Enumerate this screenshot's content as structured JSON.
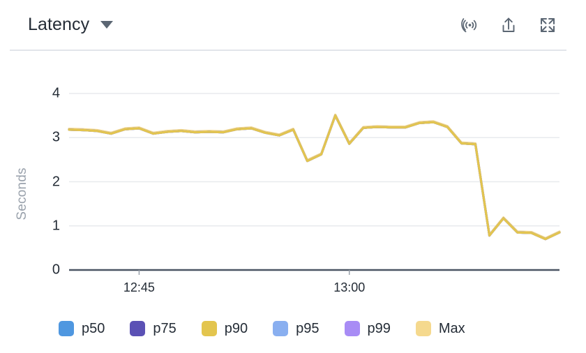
{
  "header": {
    "title": "Latency",
    "caret_icon": "chevron-down-icon",
    "actions": [
      {
        "name": "live-data-icon",
        "label": "Live data"
      },
      {
        "name": "share-icon",
        "label": "Share"
      },
      {
        "name": "fullscreen-icon",
        "label": "Fullscreen"
      }
    ]
  },
  "colors": {
    "p50": "#4f97e0",
    "p75": "#5b51b5",
    "p90": "#e3c54e",
    "p95": "#89aff0",
    "p99": "#a88cf5",
    "max": "#f5d98e",
    "axis": "#4b5563",
    "grid": "#e8eaee",
    "text": "#242c36",
    "muted": "#9aa2ac",
    "divider": "#e2e5ea"
  },
  "chart_data": {
    "type": "line",
    "title": "Latency",
    "xlabel": "",
    "ylabel": "Seconds",
    "ylim": [
      0,
      4
    ],
    "yticks": [
      0,
      1,
      2,
      3,
      4
    ],
    "grid": true,
    "legend_position": "bottom",
    "xticks": [
      {
        "label": "12:45",
        "x": 5
      },
      {
        "label": "13:00",
        "x": 20
      }
    ],
    "x": [
      0,
      1,
      2,
      3,
      4,
      5,
      6,
      7,
      8,
      9,
      10,
      11,
      12,
      13,
      14,
      15,
      16,
      17,
      18,
      19,
      20,
      21,
      22,
      23,
      24,
      25,
      26,
      27,
      28,
      29,
      30,
      31,
      32,
      33,
      34
    ],
    "series": [
      {
        "name": "p50",
        "color": "#4f97e0",
        "values": [
          3.18,
          3.17,
          3.15,
          3.09,
          3.19,
          3.21,
          3.09,
          3.13,
          3.15,
          3.12,
          3.13,
          3.12,
          3.19,
          3.21,
          3.11,
          3.05,
          3.18,
          2.47,
          2.62,
          3.5,
          2.86,
          3.22,
          3.24,
          3.23,
          3.23,
          3.33,
          3.35,
          3.24,
          2.87,
          2.85,
          0.78,
          1.17,
          0.85,
          0.84,
          0.7,
          0.85
        ]
      },
      {
        "name": "p75",
        "color": "#5b51b5",
        "values": [
          3.18,
          3.17,
          3.15,
          3.09,
          3.19,
          3.21,
          3.09,
          3.13,
          3.15,
          3.12,
          3.13,
          3.12,
          3.19,
          3.21,
          3.11,
          3.05,
          3.18,
          2.47,
          2.62,
          3.5,
          2.86,
          3.22,
          3.24,
          3.23,
          3.23,
          3.33,
          3.35,
          3.24,
          2.87,
          2.85,
          0.78,
          1.17,
          0.85,
          0.84,
          0.7,
          0.85
        ]
      },
      {
        "name": "p90",
        "color": "#e3c54e",
        "values": [
          3.18,
          3.17,
          3.15,
          3.09,
          3.19,
          3.21,
          3.09,
          3.13,
          3.15,
          3.12,
          3.13,
          3.12,
          3.19,
          3.21,
          3.11,
          3.05,
          3.18,
          2.47,
          2.62,
          3.5,
          2.86,
          3.22,
          3.24,
          3.23,
          3.23,
          3.33,
          3.35,
          3.24,
          2.87,
          2.85,
          0.78,
          1.17,
          0.85,
          0.84,
          0.7,
          0.85
        ]
      },
      {
        "name": "p95",
        "color": "#89aff0",
        "values": [
          3.18,
          3.17,
          3.15,
          3.09,
          3.19,
          3.21,
          3.09,
          3.13,
          3.15,
          3.12,
          3.13,
          3.12,
          3.19,
          3.21,
          3.11,
          3.05,
          3.18,
          2.47,
          2.62,
          3.5,
          2.86,
          3.22,
          3.24,
          3.23,
          3.23,
          3.33,
          3.35,
          3.24,
          2.87,
          2.85,
          0.78,
          1.17,
          0.85,
          0.84,
          0.7,
          0.85
        ]
      },
      {
        "name": "p99",
        "color": "#a88cf5",
        "values": [
          3.18,
          3.17,
          3.15,
          3.09,
          3.19,
          3.21,
          3.09,
          3.13,
          3.15,
          3.12,
          3.13,
          3.12,
          3.19,
          3.21,
          3.11,
          3.05,
          3.18,
          2.47,
          2.62,
          3.5,
          2.86,
          3.22,
          3.24,
          3.23,
          3.23,
          3.33,
          3.35,
          3.24,
          2.87,
          2.85,
          0.78,
          1.17,
          0.85,
          0.84,
          0.7,
          0.85
        ]
      },
      {
        "name": "Max",
        "color": "#f5d98e",
        "values": [
          3.2,
          3.19,
          3.17,
          3.11,
          3.21,
          3.23,
          3.11,
          3.15,
          3.17,
          3.14,
          3.15,
          3.14,
          3.21,
          3.23,
          3.13,
          3.07,
          3.2,
          2.49,
          2.64,
          3.52,
          2.88,
          3.24,
          3.26,
          3.25,
          3.25,
          3.35,
          3.37,
          3.26,
          2.89,
          2.87,
          0.8,
          1.19,
          0.87,
          0.86,
          0.72,
          0.87
        ]
      }
    ]
  },
  "legend": {
    "items": [
      {
        "label": "p50",
        "color": "#4f97e0"
      },
      {
        "label": "p75",
        "color": "#5b51b5"
      },
      {
        "label": "p90",
        "color": "#e3c54e"
      },
      {
        "label": "p95",
        "color": "#89aff0"
      },
      {
        "label": "p99",
        "color": "#a88cf5"
      },
      {
        "label": "Max",
        "color": "#f5d98e"
      }
    ]
  }
}
